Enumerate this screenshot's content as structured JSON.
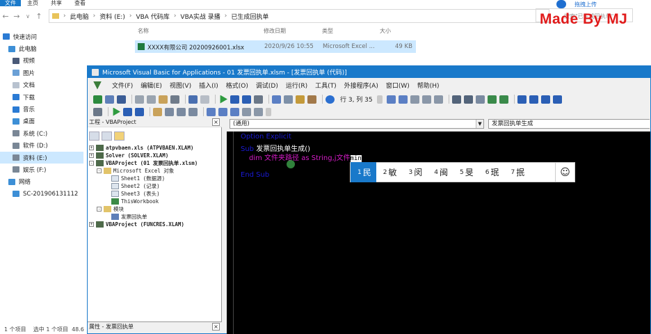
{
  "explorer": {
    "ribbon_tabs": [
      "文件",
      "主页",
      "共享",
      "查看"
    ],
    "breadcrumb": [
      "此电脑",
      "资料 (E:)",
      "VBA 代码库",
      "VBA实战 录播",
      "已生成回执单"
    ],
    "search_placeholder": "搜索\"已生成回执单\"",
    "cloud_button": "拖拽上传",
    "sidebar": [
      "快速访问",
      "此电脑",
      "视频",
      "图片",
      "文档",
      "下载",
      "音乐",
      "桌面",
      "系统 (C:)",
      "软件 (D:)",
      "资料 (E:)",
      "娱乐 (F:)",
      "网络",
      "SC-201906131112"
    ],
    "columns": {
      "name": "名称",
      "modified": "修改日期",
      "type": "类型",
      "size": "大小"
    },
    "file": {
      "name": "XXXX有限公司 20200926001.xlsx",
      "modified": "2020/9/26 10:55",
      "type": "Microsoft Excel ...",
      "size": "49 KB"
    },
    "status": "1 个项目    选中 1 个项目  48.6"
  },
  "watermark": "Made By MJ",
  "vbe": {
    "title": "Microsoft Visual Basic for Applications - 01 发票回执单.xlsm - [发票回执单 (代码)]",
    "menu": [
      "文件(F)",
      "编辑(E)",
      "视图(V)",
      "插入(I)",
      "格式(O)",
      "调试(D)",
      "运行(R)",
      "工具(T)",
      "外接程序(A)",
      "窗口(W)",
      "帮助(H)"
    ],
    "position": "行 3, 列 35",
    "project_pane_title": "工程 - VBAProject",
    "tree": [
      {
        "label": "atpvbaen.xls (ATPVBAEN.XLAM)",
        "level": 0,
        "exp": "+",
        "bold": true
      },
      {
        "label": "Solver (SOLVER.XLAM)",
        "level": 0,
        "exp": "+",
        "bold": true
      },
      {
        "label": "VBAProject (01 发票回执单.xlsm)",
        "level": 0,
        "exp": "-",
        "bold": true
      },
      {
        "label": "Microsoft Excel 对象",
        "level": 1,
        "exp": "-",
        "bold": false
      },
      {
        "label": "Sheet1 (数据源)",
        "level": 2,
        "exp": "",
        "bold": false
      },
      {
        "label": "Sheet2 (记录)",
        "level": 2,
        "exp": "",
        "bold": false
      },
      {
        "label": "Sheet3 (表头)",
        "level": 2,
        "exp": "",
        "bold": false
      },
      {
        "label": "ThisWorkbook",
        "level": 2,
        "exp": "",
        "bold": false
      },
      {
        "label": "模块",
        "level": 1,
        "exp": "-",
        "bold": false
      },
      {
        "label": "发票回执单",
        "level": 2,
        "exp": "",
        "bold": false
      },
      {
        "label": "VBAProject (FUNCRES.XLAM)",
        "level": 0,
        "exp": "+",
        "bold": true
      }
    ],
    "properties_title": "属性 - 发票回执单",
    "combo_object": "(通用)",
    "combo_proc": "发票回执单生成",
    "code": {
      "line1": "Option Explicit",
      "line2_kw": "Sub",
      "line2_name": " 发票回执单生成()",
      "line3_text": "dim 文件夹路径 as String,j文件",
      "line3_sel": "min",
      "line4": "End Sub"
    },
    "ime": [
      {
        "n": "1",
        "c": "民"
      },
      {
        "n": "2",
        "c": "敏"
      },
      {
        "n": "3",
        "c": "闵"
      },
      {
        "n": "4",
        "c": "闽"
      },
      {
        "n": "5",
        "c": "旻"
      },
      {
        "n": "6",
        "c": "珉"
      },
      {
        "n": "7",
        "c": "抿"
      }
    ],
    "ime_emoji": "☺"
  }
}
